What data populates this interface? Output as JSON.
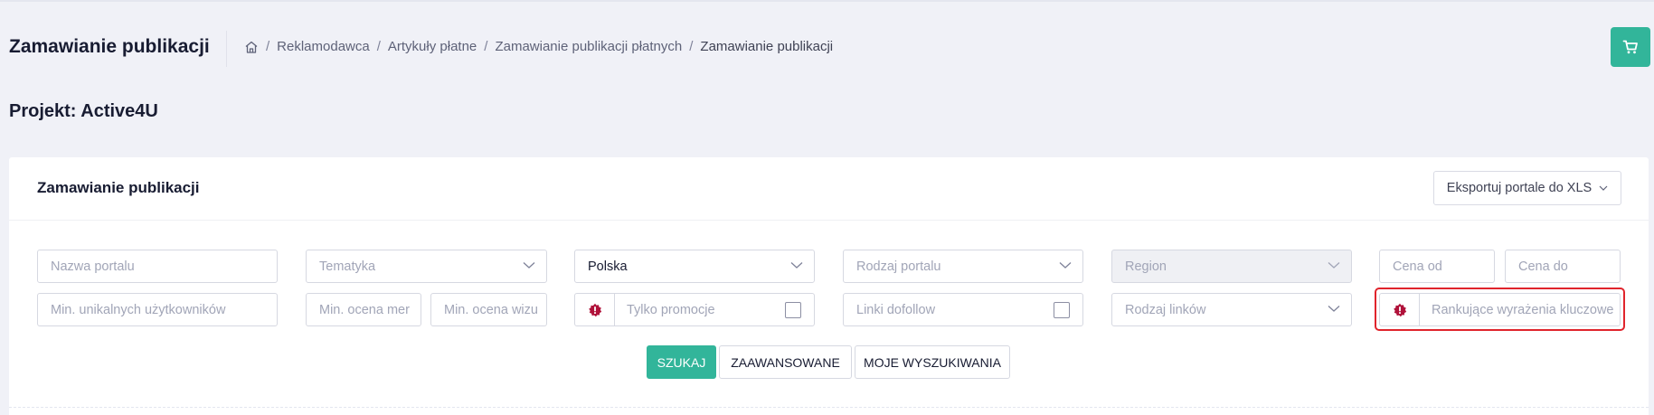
{
  "header": {
    "title": "Zamawianie publikacji",
    "breadcrumb": [
      "Reklamodawca",
      "Artykuły płatne",
      "Zamawianie publikacji płatnych",
      "Zamawianie publikacji"
    ],
    "home_icon": "home-icon",
    "cart_icon": "cart-icon",
    "accent_color": "#32b59a"
  },
  "project": {
    "title": "Projekt: Active4U"
  },
  "card": {
    "title": "Zamawianie publikacji",
    "export_label": "Eksportuj portale do XLS"
  },
  "filters": {
    "portal_name_placeholder": "Nazwa portalu",
    "topic_placeholder": "Tematyka",
    "country_value": "Polska",
    "portal_type_placeholder": "Rodzaj portalu",
    "region_placeholder": "Region",
    "price_from_placeholder": "Cena od",
    "price_to_placeholder": "Cena do",
    "min_users_placeholder": "Min. unikalnych użytkowników",
    "min_merit_placeholder": "Min. ocena mer",
    "min_visual_placeholder": "Min. ocena wizu",
    "promo_only_label": "Tylko promocje",
    "dofollow_label": "Linki dofollow",
    "link_type_placeholder": "Rodzaj linków",
    "keywords_placeholder": "Rankujące wyrażenia kluczowe",
    "badge_icon": "alert-badge-icon",
    "highlight_color": "#e0242c"
  },
  "buttons": {
    "search": "SZUKAJ",
    "advanced": "ZAAWANSOWANE",
    "my_searches": "MOJE WYSZUKIWANIA"
  }
}
